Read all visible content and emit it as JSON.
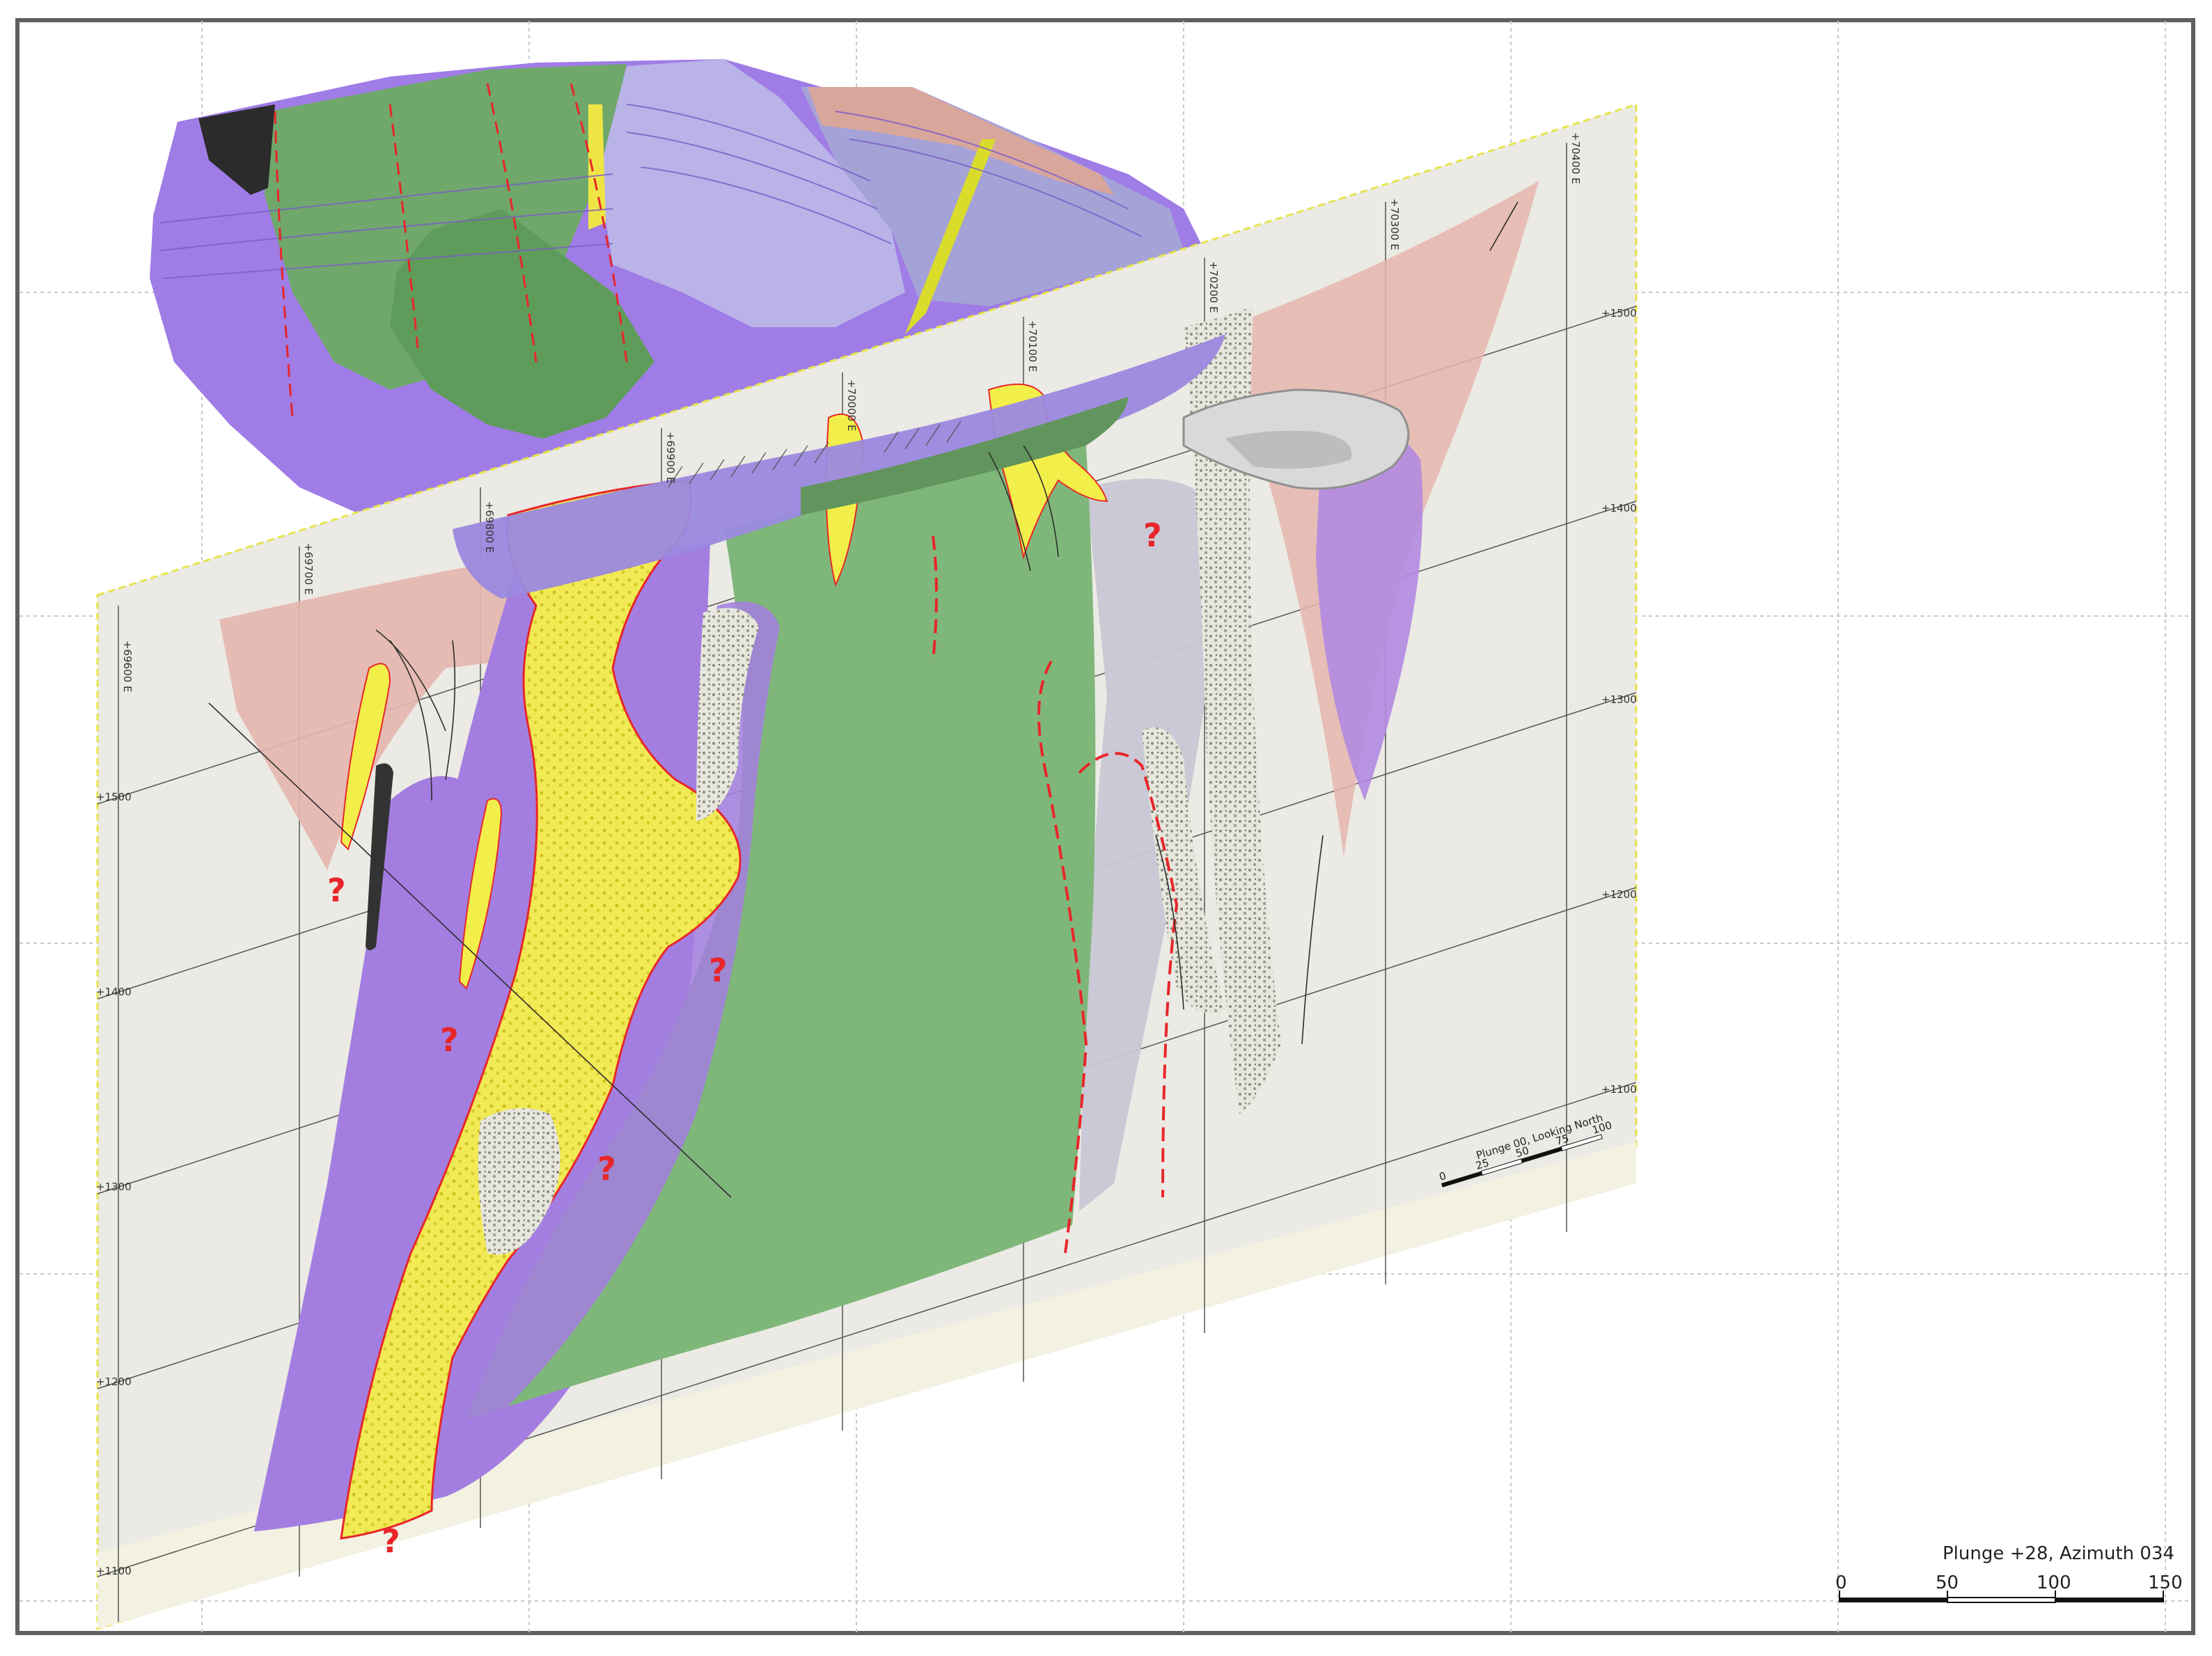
{
  "view": {
    "orientation_label": "Plunge +28, Azimuth 034"
  },
  "section_scale": {
    "title": "Plunge 00, Looking North",
    "ticks": [
      "0",
      "25",
      "50",
      "75",
      "100"
    ]
  },
  "scale_bar": {
    "ticks": [
      "0",
      "50",
      "100",
      "150"
    ]
  },
  "easting_labels": [
    "+69600 E",
    "+69700 E",
    "+69800 E",
    "+69900 E",
    "+70000 E",
    "+70100 E",
    "+70200 E",
    "+70300 E",
    "+70400 E"
  ],
  "elevation_labels_left": [
    "+1500",
    "+1400",
    "+1300",
    "+1200",
    "+1100"
  ],
  "elevation_labels_right": [
    "+1500",
    "+1400",
    "+1300",
    "+1200",
    "+1100"
  ],
  "uncertainty_marker": "?",
  "colors": {
    "purple_unit": "#a37ee0",
    "green_unit": "#7fb77a",
    "yellow_ore": "#f3ef4a",
    "pink_unit": "#e6b6ad",
    "grey_unit": "#c9c7d4",
    "section_plane": "#e9e8e1",
    "fault": "#e8262a"
  }
}
